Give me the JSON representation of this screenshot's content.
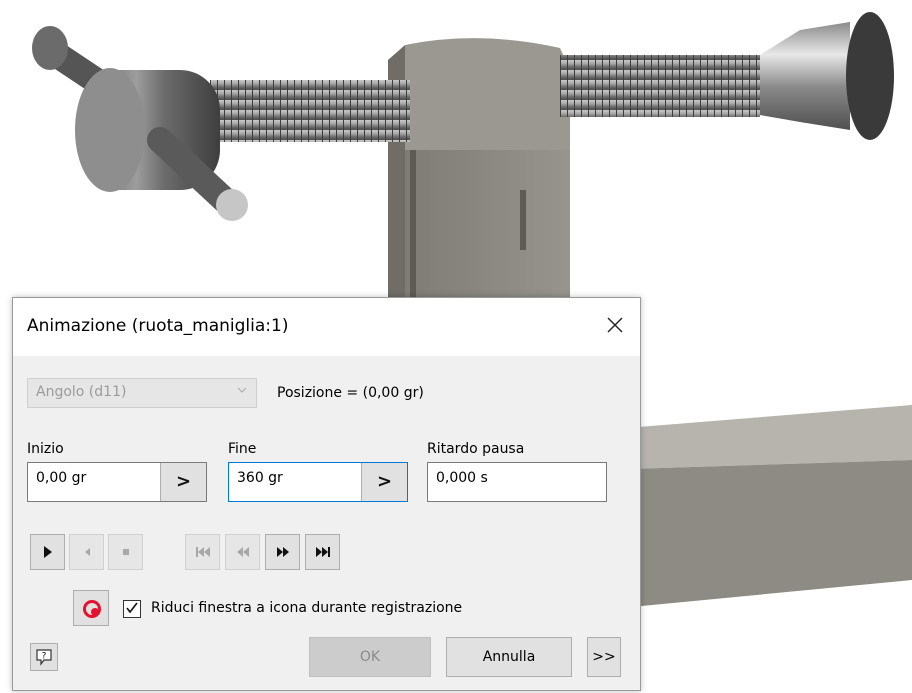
{
  "dialog": {
    "title": "Animazione (ruota_maniglia:1)",
    "close_icon": "close-icon",
    "parameter_select": {
      "value": "Angolo (d11)",
      "disabled": true
    },
    "position_text": "Posizione = (0,00 gr)",
    "start": {
      "label": "Inizio",
      "value": "0,00 gr",
      "arrow": ">"
    },
    "end": {
      "label": "Fine",
      "value": "360 gr",
      "arrow": ">"
    },
    "pause_delay": {
      "label": "Ritardo pausa",
      "value": "0,000 s"
    },
    "playback": [
      {
        "icon": "play-forward-icon",
        "enabled": true
      },
      {
        "icon": "play-reverse-icon",
        "enabled": false
      },
      {
        "icon": "stop-icon",
        "enabled": false
      },
      {
        "icon": "go-to-start-icon",
        "enabled": false
      },
      {
        "icon": "step-back-icon",
        "enabled": false
      },
      {
        "icon": "step-forward-icon",
        "enabled": true
      },
      {
        "icon": "go-to-end-icon",
        "enabled": true
      }
    ],
    "record_icon": "record-icon",
    "minimize_checkbox": {
      "label": "Riduci finestra a icona durante registrazione",
      "checked": true
    },
    "help_icon": "help-icon",
    "ok_label": "OK",
    "cancel_label": "Annulla",
    "more_label": ">>"
  },
  "colors": {
    "dialog_bg": "#f0f0f0",
    "record_red": "#e8112d",
    "focus_blue": "#0078d7",
    "model_gray": "#8d8b84"
  }
}
